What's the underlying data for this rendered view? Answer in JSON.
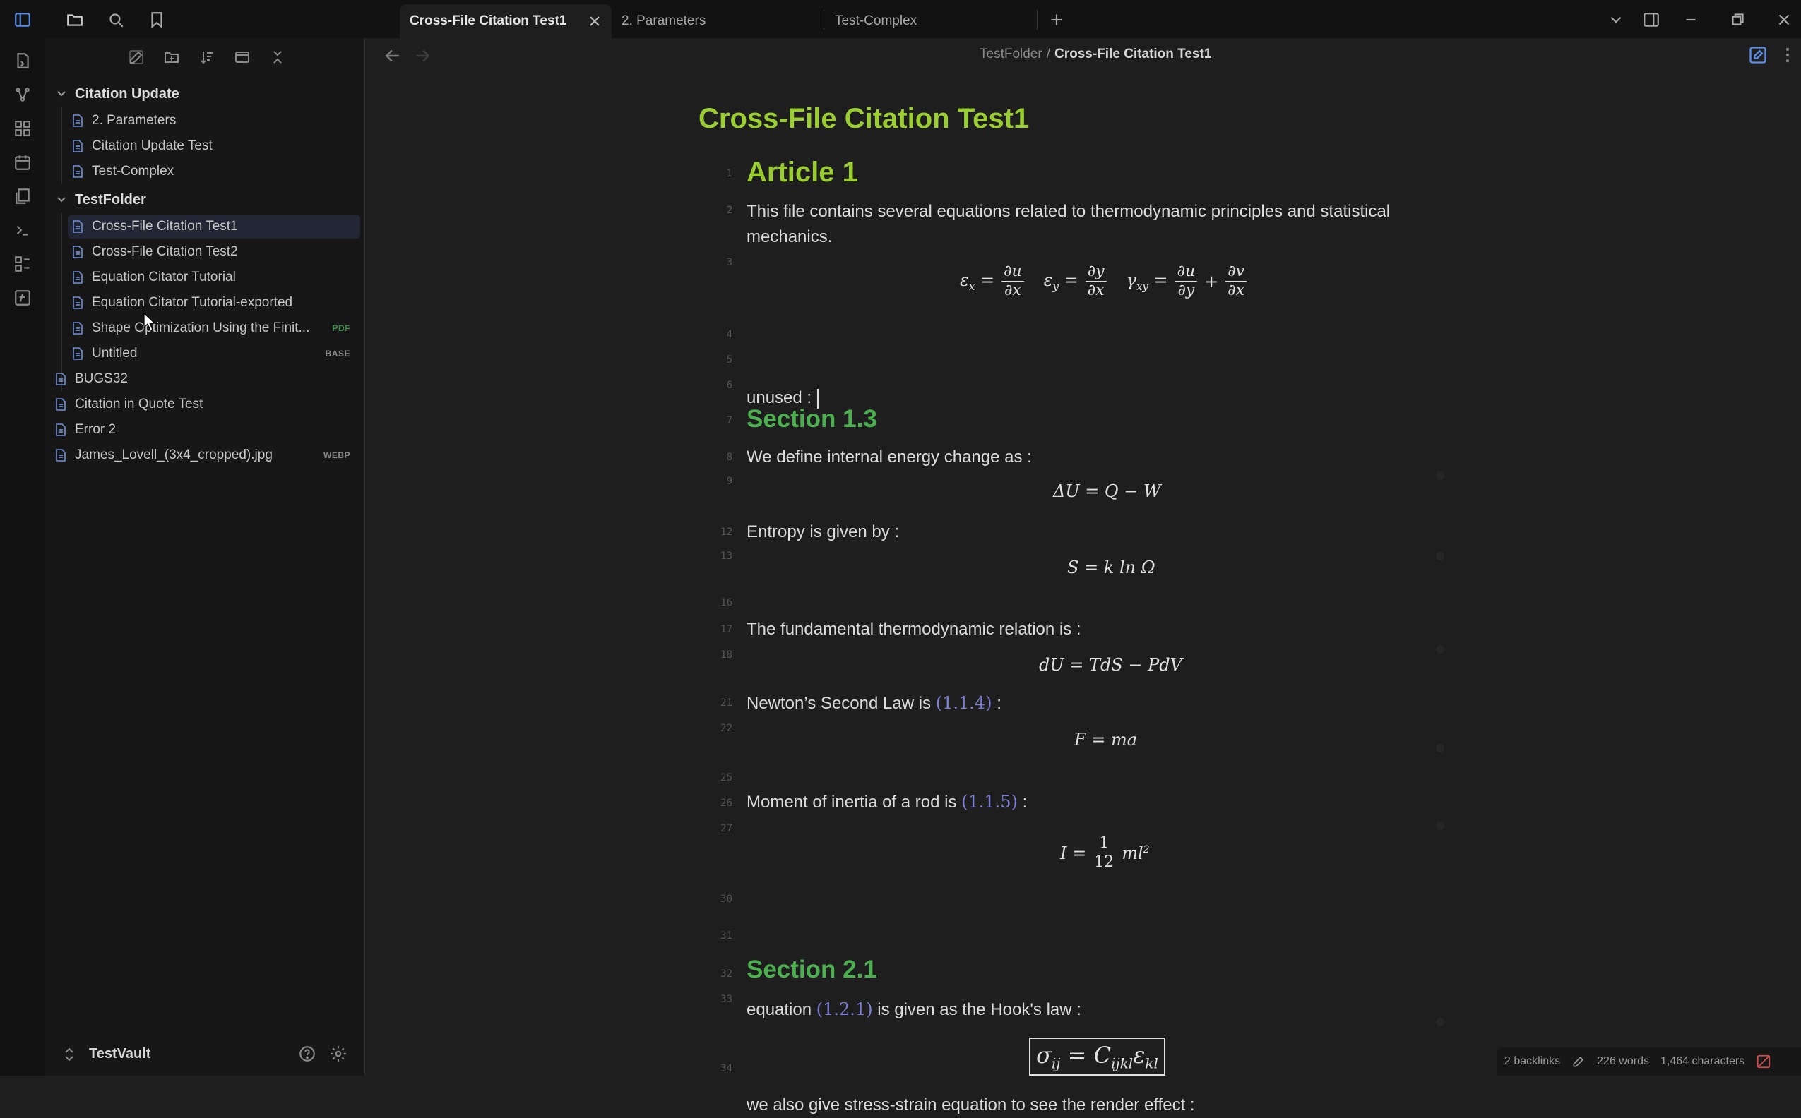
{
  "tabs": [
    {
      "label": "Cross-File Citation Test1",
      "active": true
    },
    {
      "label": "2. Parameters",
      "active": false
    },
    {
      "label": "Test-Complex",
      "active": false
    }
  ],
  "sidebar": {
    "folders": [
      {
        "name": "Citation Update",
        "files": [
          "2. Parameters",
          "Citation Update Test",
          "Test-Complex"
        ]
      },
      {
        "name": "TestFolder",
        "files": [
          {
            "name": "Cross-File Citation Test1",
            "selected": true
          },
          {
            "name": "Cross-File Citation Test2"
          },
          {
            "name": "Equation Citator Tutorial"
          },
          {
            "name": "Equation Citator Tutorial-exported"
          },
          {
            "name": "Shape Optimization Using the Finit...",
            "badge": "PDF"
          },
          {
            "name": "Untitled",
            "badge": "BASE"
          }
        ]
      }
    ],
    "root_files": [
      {
        "name": "BUGS32"
      },
      {
        "name": "Citation in Quote Test"
      },
      {
        "name": "Error 2"
      },
      {
        "name": "James_Lovell_(3x4_cropped).jpg",
        "badge": "WEBP"
      }
    ],
    "vault_name": "TestVault"
  },
  "breadcrumb": {
    "folder": "TestFolder",
    "sep": "/",
    "current": "Cross-File Citation Test1"
  },
  "note": {
    "title": "Cross-File Citation Test1",
    "article_heading": "Article 1",
    "intro_line1": "This file contains several equations related to thermodynamic principles and statistical",
    "intro_line2": "mechanics.",
    "unused_label": "unused :",
    "section13": "Section 1.3",
    "p_internal": "We define internal energy change as :",
    "eq_internal": "ΔU = Q − W",
    "p_entropy": "Entropy is given by  :",
    "eq_entropy": "S = k ln Ω",
    "p_fundamental": "The fundamental thermodynamic relation is :",
    "eq_fundamental": "dU = TdS − PdV",
    "p_newton_pre": "Newton’s Second Law is",
    "ref_newton": "(1.1.4)",
    "p_newton_post": ":",
    "eq_newton": "F = ma",
    "p_moment_pre": "Moment of inertia of a rod is",
    "ref_moment": "(1.1.5)",
    "p_moment_post": ":",
    "section21": "Section 2.1",
    "p_hooke_pre": "equation",
    "ref_hooke": "(1.2.1)",
    "p_hooke_post": "is given as the Hook's law :",
    "p_stress": "we also give stress-strain equation to see the render effect  :"
  },
  "line_numbers": [
    "1",
    "2",
    "3",
    "4",
    "5",
    "6",
    "7",
    "8",
    "9",
    "12",
    "13",
    "16",
    "17",
    "18",
    "21",
    "22",
    "25",
    "26",
    "27",
    "30",
    "31",
    "32",
    "33",
    "34"
  ],
  "status": {
    "backlinks": "2 backlinks",
    "words": "226 words",
    "chars": "1,464 characters"
  },
  "colors": {
    "heading_yellow": "#9acd32",
    "heading_green": "#4caf50",
    "accent": "#7b7fd6"
  },
  "icons": [
    "sidebar-toggle-icon",
    "folder-icon",
    "search-icon",
    "bookmark-icon",
    "new-tab-icon",
    "chevron-down-icon",
    "layout-icon",
    "minimize-icon",
    "restore-icon",
    "close-icon"
  ]
}
